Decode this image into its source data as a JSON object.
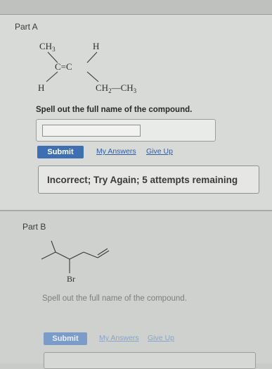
{
  "part_a": {
    "label": "Part A",
    "structure": {
      "ch3_top": "CH3",
      "h_top": "H",
      "double_bond": "C=C",
      "h_bottom": "H",
      "ch2_ch3": "CH2—CH3"
    },
    "question": "Spell out the full name of the compound.",
    "answer_value": "",
    "submit_label": "Submit",
    "my_answers_label": "My Answers",
    "give_up_label": "Give Up",
    "feedback": "Incorrect; Try Again; 5 attempts remaining"
  },
  "part_b": {
    "label": "Part B",
    "structure": {
      "br": "Br"
    },
    "question": "Spell out the full name of the compound.",
    "submit_label": "Submit",
    "my_answers_label": "My Answers",
    "give_up_label": "Give Up"
  }
}
